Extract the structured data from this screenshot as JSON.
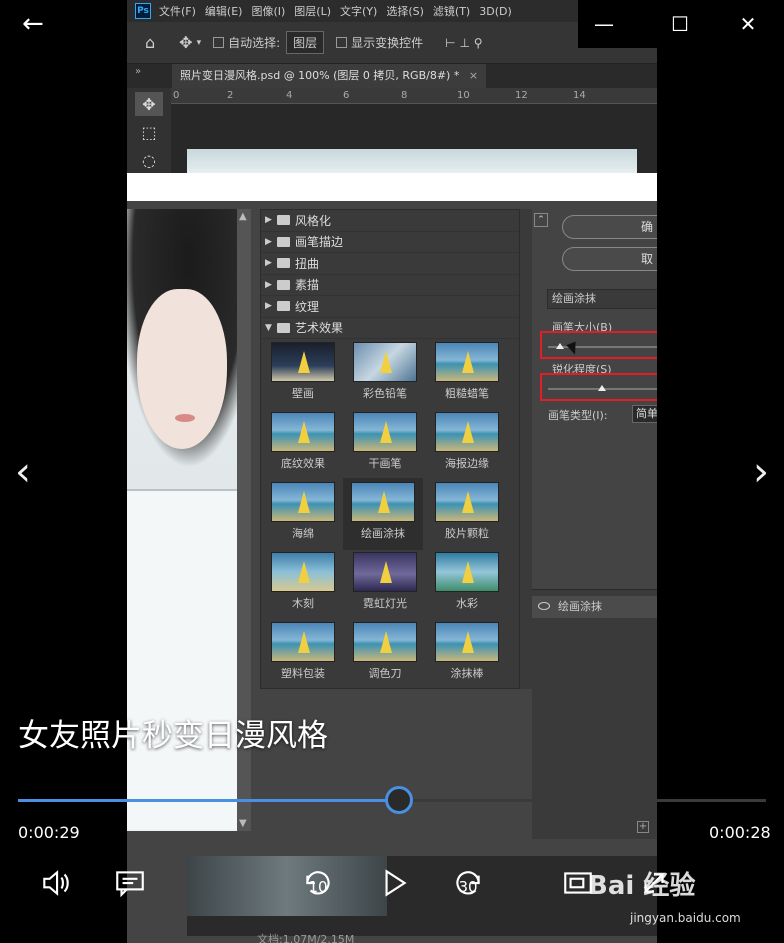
{
  "photoshop": {
    "logo": "Ps",
    "menus": [
      "文件(F)",
      "编辑(E)",
      "图像(I)",
      "图层(L)",
      "文字(Y)",
      "选择(S)",
      "滤镜(T)",
      "3D(D)"
    ],
    "options": {
      "auto_select_label": "自动选择:",
      "auto_select_value": "图层",
      "show_transform_label": "显示变换控件"
    },
    "doc_tab": "照片变日漫风格.psd @ 100% (图层 0 拷贝, RGB/8#) *",
    "ruler_numbers": [
      "0",
      "2",
      "4",
      "6",
      "8",
      "10",
      "12",
      "14"
    ],
    "doc_status": "文档:1.07M/2.15M"
  },
  "filter_gallery": {
    "categories": [
      {
        "label": "风格化",
        "expanded": false
      },
      {
        "label": "画笔描边",
        "expanded": false
      },
      {
        "label": "扭曲",
        "expanded": false
      },
      {
        "label": "素描",
        "expanded": false
      },
      {
        "label": "纹理",
        "expanded": false
      },
      {
        "label": "艺术效果",
        "expanded": true
      }
    ],
    "thumbnails": [
      "壁画",
      "彩色铅笔",
      "粗糙蜡笔",
      "底纹效果",
      "干画笔",
      "海报边缘",
      "海绵",
      "绘画涂抹",
      "胶片颗粒",
      "木刻",
      "霓虹灯光",
      "水彩",
      "塑料包装",
      "调色刀",
      "涂抹棒"
    ],
    "selected_thumbnail": "绘画涂抹",
    "buttons": {
      "ok": "确",
      "cancel": "取"
    },
    "filter_select": "绘画涂抹",
    "params": {
      "brush_size_label": "画笔大小(B)",
      "sharpness_label": "锐化程度(S)",
      "brush_type_label": "画笔类型(I):",
      "brush_type_value": "简单"
    },
    "brush_size_level": 0.1,
    "sharpness_level": 0.45,
    "layer_name": "绘画涂抹"
  },
  "player": {
    "title": "女友照片秒变日漫风格",
    "elapsed": "0:00:29",
    "remaining": "0:00:28",
    "progress": 0.51,
    "skip_back": "10",
    "skip_forward": "30",
    "accent": "#4a90e2"
  },
  "watermark": {
    "text": "Bai 经验",
    "url": "jingyan.baidu.com"
  }
}
